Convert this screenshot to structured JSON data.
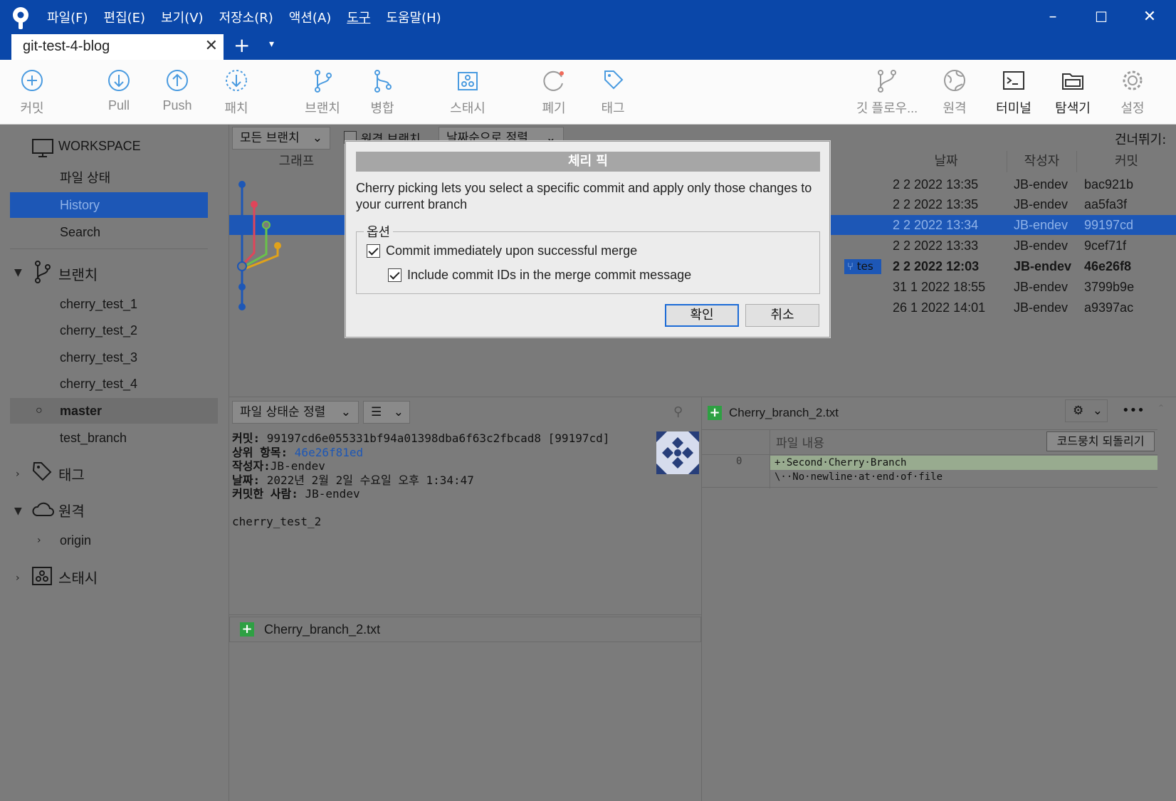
{
  "window": {
    "tab_title": "git-test-4-blog",
    "minimize": "–",
    "maximize": "☐",
    "close": "✕",
    "tab_close": "✕",
    "tab_add": "+",
    "tab_menu": "▾"
  },
  "menu": [
    "파일(F)",
    "편집(E)",
    "보기(V)",
    "저장소(R)",
    "액션(A)",
    "도구",
    "도움말(H)"
  ],
  "toolbar": {
    "commit": "커밋",
    "pull": "Pull",
    "push": "Push",
    "patch": "패치",
    "branch": "브랜치",
    "merge": "병합",
    "stash": "스태시",
    "discard": "폐기",
    "tag": "태그",
    "gitflow": "깃 플로우...",
    "remote": "원격",
    "terminal": "터미널",
    "explorer": "탐색기",
    "settings": "설정"
  },
  "sidebar": {
    "workspace": "WORKSPACE",
    "file_status": "파일 상태",
    "history": "History",
    "search": "Search",
    "branches_header": "브랜치",
    "branches": [
      "cherry_test_1",
      "cherry_test_2",
      "cherry_test_3",
      "cherry_test_4",
      "master",
      "test_branch"
    ],
    "tags_header": "태그",
    "remotes_header": "원격",
    "origin": "origin",
    "stash_header": "스태시"
  },
  "history": {
    "branch_filter": "모든 브랜치",
    "remote_branches": "원격 브랜치",
    "sort": "날짜순으로 정렬",
    "jump": "건너뛰기:",
    "columns": {
      "graph": "그래프",
      "date": "날짜",
      "author": "작성자",
      "commit": "커밋"
    },
    "rows": [
      {
        "date": "2 2 2022 13:35",
        "author": "JB-endev",
        "commit": "bac921b"
      },
      {
        "date": "2 2 2022 13:35",
        "author": "JB-endev",
        "commit": "aa5fa3f"
      },
      {
        "date": "2 2 2022 13:34",
        "author": "JB-endev",
        "commit": "99197cd"
      },
      {
        "date": "2 2 2022 13:33",
        "author": "JB-endev",
        "commit": "9cef71f"
      },
      {
        "date": "2 2 2022 12:03",
        "author": "JB-endev",
        "commit": "46e26f8"
      },
      {
        "date": "31 1 2022 18:55",
        "author": "JB-endev",
        "commit": "3799b9e"
      },
      {
        "date": "26 1 2022 14:01",
        "author": "JB-endev",
        "commit": "a9397ac"
      }
    ],
    "branch_badge": "tes"
  },
  "details": {
    "sort": "파일 상태순 정렬",
    "commit_label": "커밋:",
    "commit_value": "99197cd6e055331bf94a01398dba6f63c2fbcad8 [99197cd]",
    "parent_label": "상위 항목:",
    "parent_value": "46e26f81ed",
    "author_label": "작성자:",
    "author_value": "JB-endev",
    "date_label": "날짜:",
    "date_value": "2022년 2월 2일 수요일 오후 1:34:47",
    "committer_label": "커밋한 사람:",
    "committer_value": "JB-endev",
    "message": "cherry_test_2",
    "file": "Cherry_branch_2.txt"
  },
  "diff": {
    "file": "Cherry_branch_2.txt",
    "header": "파일 내용",
    "revert": "코드뭉치 되돌리기",
    "line_no": "0",
    "line1": "+·Second·Cherry·Branch",
    "line2": "\\··No·newline·at·end·of·file",
    "more": "•••"
  },
  "dialog": {
    "title": "체리 픽",
    "desc": "Cherry picking lets you select a specific commit and apply only those changes to your current branch",
    "options": "옵션",
    "opt1": "Commit immediately upon successful merge",
    "opt2": "Include commit IDs in the merge commit message",
    "ok": "확인",
    "cancel": "취소"
  },
  "colors": {
    "accent": "#0a47a9",
    "selection": "#1d57b6",
    "added": "#2ea043"
  }
}
